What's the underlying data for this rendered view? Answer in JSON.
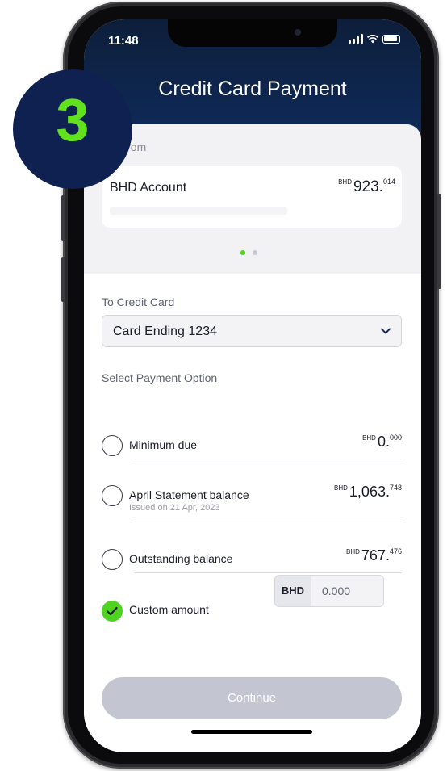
{
  "status_bar": {
    "time": "11:48"
  },
  "header": {
    "title": "Credit Card Payment"
  },
  "step_badge": "3",
  "transfer_from": {
    "label": "Transfer from",
    "visible_label": "sfer from",
    "account": {
      "name": "BHD Account",
      "currency": "BHD",
      "amount_int": "923.",
      "amount_dec": "014"
    }
  },
  "pager": {
    "count": 2,
    "active_index": 0,
    "active_color": "#4ed31f",
    "inactive_color": "#c7c9d2"
  },
  "to_credit_card": {
    "label": "To Credit Card",
    "selected": "Card Ending 1234"
  },
  "payment_option": {
    "label": "Select Payment Option",
    "options": [
      {
        "label": "Minimum due",
        "sub": "",
        "currency": "BHD",
        "amount_int": "0.",
        "amount_dec": "000",
        "checked": false
      },
      {
        "label": "April Statement balance",
        "sub": "Issued on 21 Apr, 2023",
        "currency": "BHD",
        "amount_int": "1,063.",
        "amount_dec": "748",
        "checked": false
      },
      {
        "label": "Outstanding balance",
        "sub": "",
        "currency": "BHD",
        "amount_int": "767.",
        "amount_dec": "476",
        "checked": false
      },
      {
        "label": "Custom amount",
        "sub": "",
        "checked": true
      }
    ],
    "custom_amount": {
      "currency": "BHD",
      "value": "0.000"
    }
  },
  "continue_button": {
    "label": "Continue"
  },
  "colors": {
    "header": "#0f2b5a",
    "accent_green": "#4ed31f",
    "badge": "#0f2150",
    "badge_text": "#62e21c",
    "button_disabled": "#c3c5d0"
  }
}
